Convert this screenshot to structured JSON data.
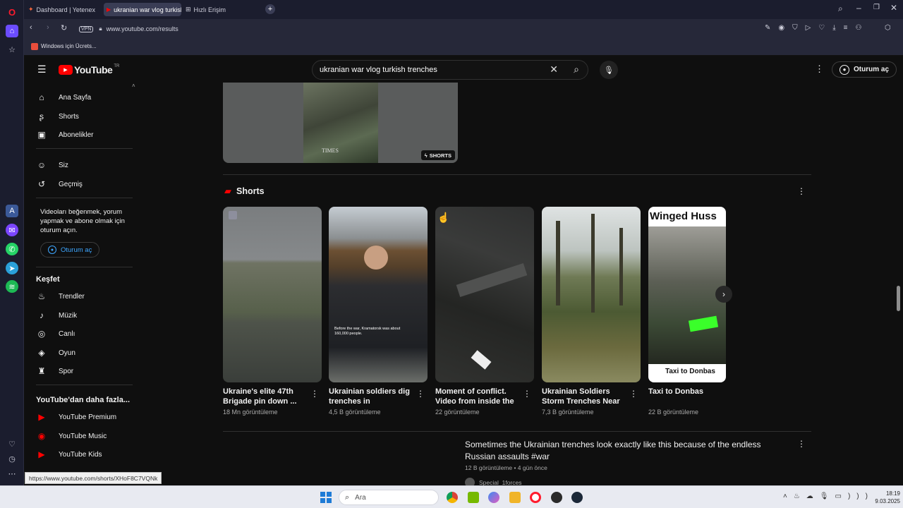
{
  "browser": {
    "tabs": [
      {
        "label": "Dashboard | Yetenex"
      },
      {
        "label": "ukranian war vlog turkish"
      },
      {
        "label": "Hızlı Erişim"
      }
    ],
    "url": "www.youtube.com/results",
    "vpn": "VPN",
    "bookmark": "Windows için Ücrets..."
  },
  "youtube": {
    "logo": "YouTube",
    "region": "TR",
    "search_query": "ukranian war vlog turkish trenches",
    "signin_label": "Oturum aç"
  },
  "sidebar": {
    "main": [
      {
        "label": "Ana Sayfa",
        "icon": "home-icon"
      },
      {
        "label": "Shorts",
        "icon": "shorts-icon"
      },
      {
        "label": "Abonelikler",
        "icon": "subscriptions-icon"
      }
    ],
    "you": [
      {
        "label": "Siz",
        "icon": "user-icon"
      },
      {
        "label": "Geçmiş",
        "icon": "history-icon"
      }
    ],
    "signin_prompt": "Videoları beğenmek, yorum yapmak ve abone olmak için oturum açın.",
    "signin_label": "Oturum aç",
    "explore_title": "Keşfet",
    "explore": [
      {
        "label": "Trendler",
        "icon": "trending-icon"
      },
      {
        "label": "Müzik",
        "icon": "music-icon"
      },
      {
        "label": "Canlı",
        "icon": "live-icon"
      },
      {
        "label": "Oyun",
        "icon": "gaming-icon"
      },
      {
        "label": "Spor",
        "icon": "trophy-icon"
      }
    ],
    "more_title": "YouTube'dan daha fazla...",
    "more": [
      {
        "label": "YouTube Premium"
      },
      {
        "label": "YouTube Music"
      },
      {
        "label": "YouTube Kids"
      }
    ]
  },
  "top_result": {
    "badge": "SHORTS",
    "watermark": "TIMES"
  },
  "shorts_section": {
    "title": "Shorts",
    "items": [
      {
        "title": "Ukraine's elite 47th Brigade pin down ...",
        "views": "18 Mn görüntüleme"
      },
      {
        "title": "Ukrainian soldiers dig trenches in preparatio...",
        "views": "4,5 B görüntüleme",
        "overlay": "Before the war, Kramatorsk was about 160,000 people."
      },
      {
        "title": "Moment of conflict. Video from inside the ...",
        "views": "22 görüntüleme"
      },
      {
        "title": "Ukrainian Soldiers Storm Trenches Near ...",
        "views": "7,3 B görüntüleme"
      },
      {
        "title": "Taxi to Donbas",
        "views": "22 B görüntüleme",
        "overlay_top": "Winged Huss",
        "overlay_bottom": "Taxi to Donbas"
      }
    ]
  },
  "next_video": {
    "title": "Sometimes the Ukrainian trenches look exactly like this because of the endless Russian assaults #war",
    "meta": "12 B görüntüleme • 4 gün önce",
    "channel": "Special_1forces"
  },
  "status_url": "https://www.youtube.com/shorts/XHoF8C7VQNk",
  "taskbar": {
    "search": "Ara",
    "time": "18:19",
    "date": "9.03.2025"
  }
}
